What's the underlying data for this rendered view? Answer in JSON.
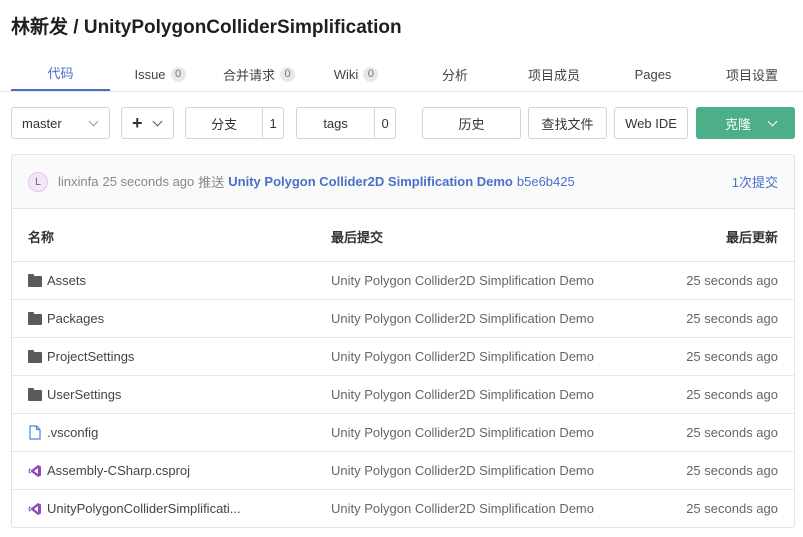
{
  "repo": {
    "owner": "林新发",
    "separator": "/",
    "name": "UnityPolygonColliderSimplification"
  },
  "tabs": [
    {
      "label": "代码",
      "count": null
    },
    {
      "label": "Issue",
      "count": "0"
    },
    {
      "label": "合并请求",
      "count": "0"
    },
    {
      "label": "Wiki",
      "count": "0"
    },
    {
      "label": "分析",
      "count": null
    },
    {
      "label": "项目成员",
      "count": null
    },
    {
      "label": "Pages",
      "count": null
    },
    {
      "label": "项目设置",
      "count": null
    }
  ],
  "toolbar": {
    "branch": "master",
    "add_label": "+",
    "branches_label": "分支",
    "branches_count": "1",
    "tags_label": "tags",
    "tags_count": "0",
    "history_label": "历史",
    "find_file_label": "查找文件",
    "web_ide_label": "Web IDE",
    "clone_label": "克隆"
  },
  "commit": {
    "avatar_letter": "L",
    "author": "linxinfa",
    "time": "25 seconds ago",
    "action": "推送",
    "message": "Unity Polygon Collider2D Simplification Demo",
    "sha": "b5e6b425",
    "commits_link": "1次提交"
  },
  "table": {
    "headers": {
      "name": "名称",
      "last_commit": "最后提交",
      "last_update": "最后更新"
    },
    "rows": [
      {
        "icon": "folder-icon",
        "name": "Assets",
        "message": "Unity Polygon Collider2D Simplification Demo",
        "time": "25 seconds ago"
      },
      {
        "icon": "folder-icon",
        "name": "Packages",
        "message": "Unity Polygon Collider2D Simplification Demo",
        "time": "25 seconds ago"
      },
      {
        "icon": "folder-icon",
        "name": "ProjectSettings",
        "message": "Unity Polygon Collider2D Simplification Demo",
        "time": "25 seconds ago"
      },
      {
        "icon": "folder-icon",
        "name": "UserSettings",
        "message": "Unity Polygon Collider2D Simplification Demo",
        "time": "25 seconds ago"
      },
      {
        "icon": "file-icon",
        "name": ".vsconfig",
        "message": "Unity Polygon Collider2D Simplification Demo",
        "time": "25 seconds ago"
      },
      {
        "icon": "visual-studio-icon",
        "name": "Assembly-CSharp.csproj",
        "message": "Unity Polygon Collider2D Simplification Demo",
        "time": "25 seconds ago"
      },
      {
        "icon": "visual-studio-icon",
        "name": "UnityPolygonColliderSimplificati...",
        "message": "Unity Polygon Collider2D Simplification Demo",
        "time": "25 seconds ago"
      }
    ]
  },
  "colors": {
    "accent": "#4a6fc7",
    "clone": "#4caf87",
    "vs_purple": "#8e4bb8"
  }
}
